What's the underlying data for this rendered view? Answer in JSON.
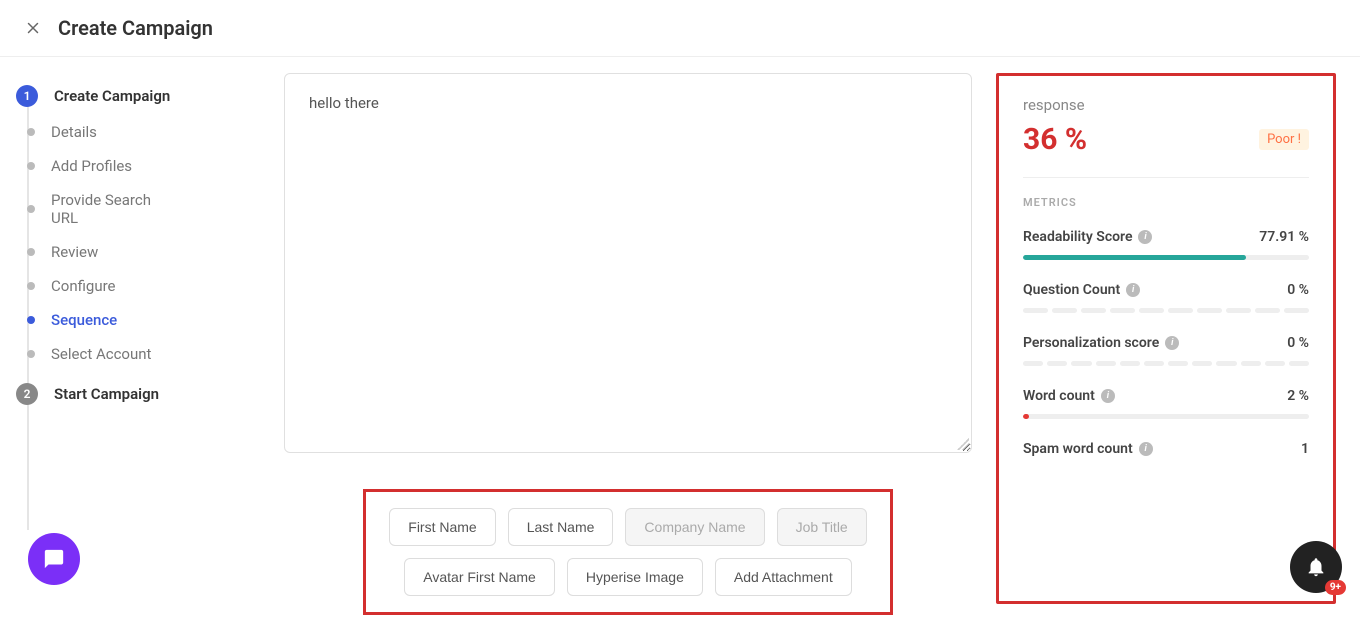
{
  "header": {
    "title": "Create Campaign"
  },
  "sidebar": {
    "step1": {
      "num": "1",
      "label": "Create Campaign"
    },
    "subs": [
      {
        "label": "Details"
      },
      {
        "label": "Add Profiles"
      },
      {
        "label": "Provide Search URL"
      },
      {
        "label": "Review"
      },
      {
        "label": "Configure"
      },
      {
        "label": "Sequence"
      },
      {
        "label": "Select Account"
      }
    ],
    "step2": {
      "num": "2",
      "label": "Start Campaign"
    }
  },
  "editor": {
    "text": "hello there"
  },
  "tokens": [
    {
      "label": "First Name",
      "disabled": false
    },
    {
      "label": "Last Name",
      "disabled": false
    },
    {
      "label": "Company Name",
      "disabled": true
    },
    {
      "label": "Job Title",
      "disabled": true
    },
    {
      "label": "Avatar First Name",
      "disabled": false
    },
    {
      "label": "Hyperise Image",
      "disabled": false
    },
    {
      "label": "Add Attachment",
      "disabled": false
    }
  ],
  "panel": {
    "response_label": "response",
    "response_pct": "36 %",
    "response_badge": "Poor !",
    "metrics_title": "METRICS",
    "metrics": {
      "readability": {
        "name": "Readability Score",
        "value": "77.91 %",
        "fill": 77.91
      },
      "question": {
        "name": "Question Count",
        "value": "0 %",
        "segs": 10
      },
      "personal": {
        "name": "Personalization score",
        "value": "0 %",
        "segs": 12
      },
      "word": {
        "name": "Word count",
        "value": "2 %",
        "fill": 1
      },
      "spam": {
        "name": "Spam word count",
        "value": "1"
      }
    }
  },
  "bell_badge": "9+"
}
